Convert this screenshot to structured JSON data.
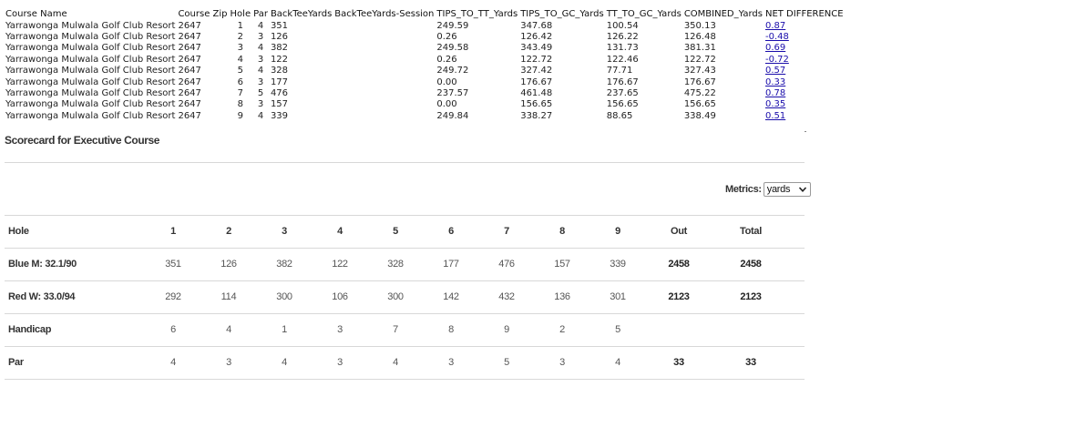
{
  "data_table": {
    "headers": [
      "Course Name",
      "Course Zip",
      "Hole",
      "Par",
      "BackTeeYards",
      "BackTeeYards-Session",
      "TIPS_TO_TT_Yards",
      "TIPS_TO_GC_Yards",
      "TT_TO_GC_Yards",
      "COMBINED_Yards",
      "NET DIFFERENCE"
    ],
    "rows": [
      [
        "Yarrawonga Mulwala Golf Club Resort",
        "2647",
        "1",
        "4",
        "351",
        "",
        "249.59",
        "347.68",
        "100.54",
        "350.13",
        "0.87"
      ],
      [
        "Yarrawonga Mulwala Golf Club Resort",
        "2647",
        "2",
        "3",
        "126",
        "",
        "0.26",
        "126.42",
        "126.22",
        "126.48",
        "-0.48"
      ],
      [
        "Yarrawonga Mulwala Golf Club Resort",
        "2647",
        "3",
        "4",
        "382",
        "",
        "249.58",
        "343.49",
        "131.73",
        "381.31",
        "0.69"
      ],
      [
        "Yarrawonga Mulwala Golf Club Resort",
        "2647",
        "4",
        "3",
        "122",
        "",
        "0.26",
        "122.72",
        "122.46",
        "122.72",
        "-0.72"
      ],
      [
        "Yarrawonga Mulwala Golf Club Resort",
        "2647",
        "5",
        "4",
        "328",
        "",
        "249.72",
        "327.42",
        "77.71",
        "327.43",
        "0.57"
      ],
      [
        "Yarrawonga Mulwala Golf Club Resort",
        "2647",
        "6",
        "3",
        "177",
        "",
        "0.00",
        "176.67",
        "176.67",
        "176.67",
        "0.33"
      ],
      [
        "Yarrawonga Mulwala Golf Club Resort",
        "2647",
        "7",
        "5",
        "476",
        "",
        "237.57",
        "461.48",
        "237.65",
        "475.22",
        "0.78"
      ],
      [
        "Yarrawonga Mulwala Golf Club Resort",
        "2647",
        "8",
        "3",
        "157",
        "",
        "0.00",
        "156.65",
        "156.65",
        "156.65",
        "0.35"
      ],
      [
        "Yarrawonga Mulwala Golf Club Resort",
        "2647",
        "9",
        "4",
        "339",
        "",
        "249.84",
        "338.27",
        "88.65",
        "338.49",
        "0.51"
      ]
    ]
  },
  "scorecard": {
    "title": "Scorecard for Executive Course",
    "metrics_label": "Metrics:",
    "metrics_value": "yards",
    "header": {
      "label": "Hole",
      "cells": [
        "1",
        "2",
        "3",
        "4",
        "5",
        "6",
        "7",
        "8",
        "9",
        "Out",
        "Total"
      ]
    },
    "rows": [
      {
        "label": "Blue M: 32.1/90",
        "cells": [
          "351",
          "126",
          "382",
          "122",
          "328",
          "177",
          "476",
          "157",
          "339",
          "2458",
          "2458"
        ]
      },
      {
        "label": "Red W: 33.0/94",
        "cells": [
          "292",
          "114",
          "300",
          "106",
          "300",
          "142",
          "432",
          "136",
          "301",
          "2123",
          "2123"
        ]
      },
      {
        "label": "Handicap",
        "cells": [
          "6",
          "4",
          "1",
          "3",
          "7",
          "8",
          "9",
          "2",
          "5",
          "",
          ""
        ]
      },
      {
        "label": "Par",
        "cells": [
          "4",
          "3",
          "4",
          "3",
          "4",
          "3",
          "5",
          "3",
          "4",
          "33",
          "33"
        ]
      }
    ]
  },
  "colors": {
    "link": "#1a0dab",
    "divider": "#d8d8d8"
  },
  "icons": {
    "select": "chevron-down-icon"
  }
}
